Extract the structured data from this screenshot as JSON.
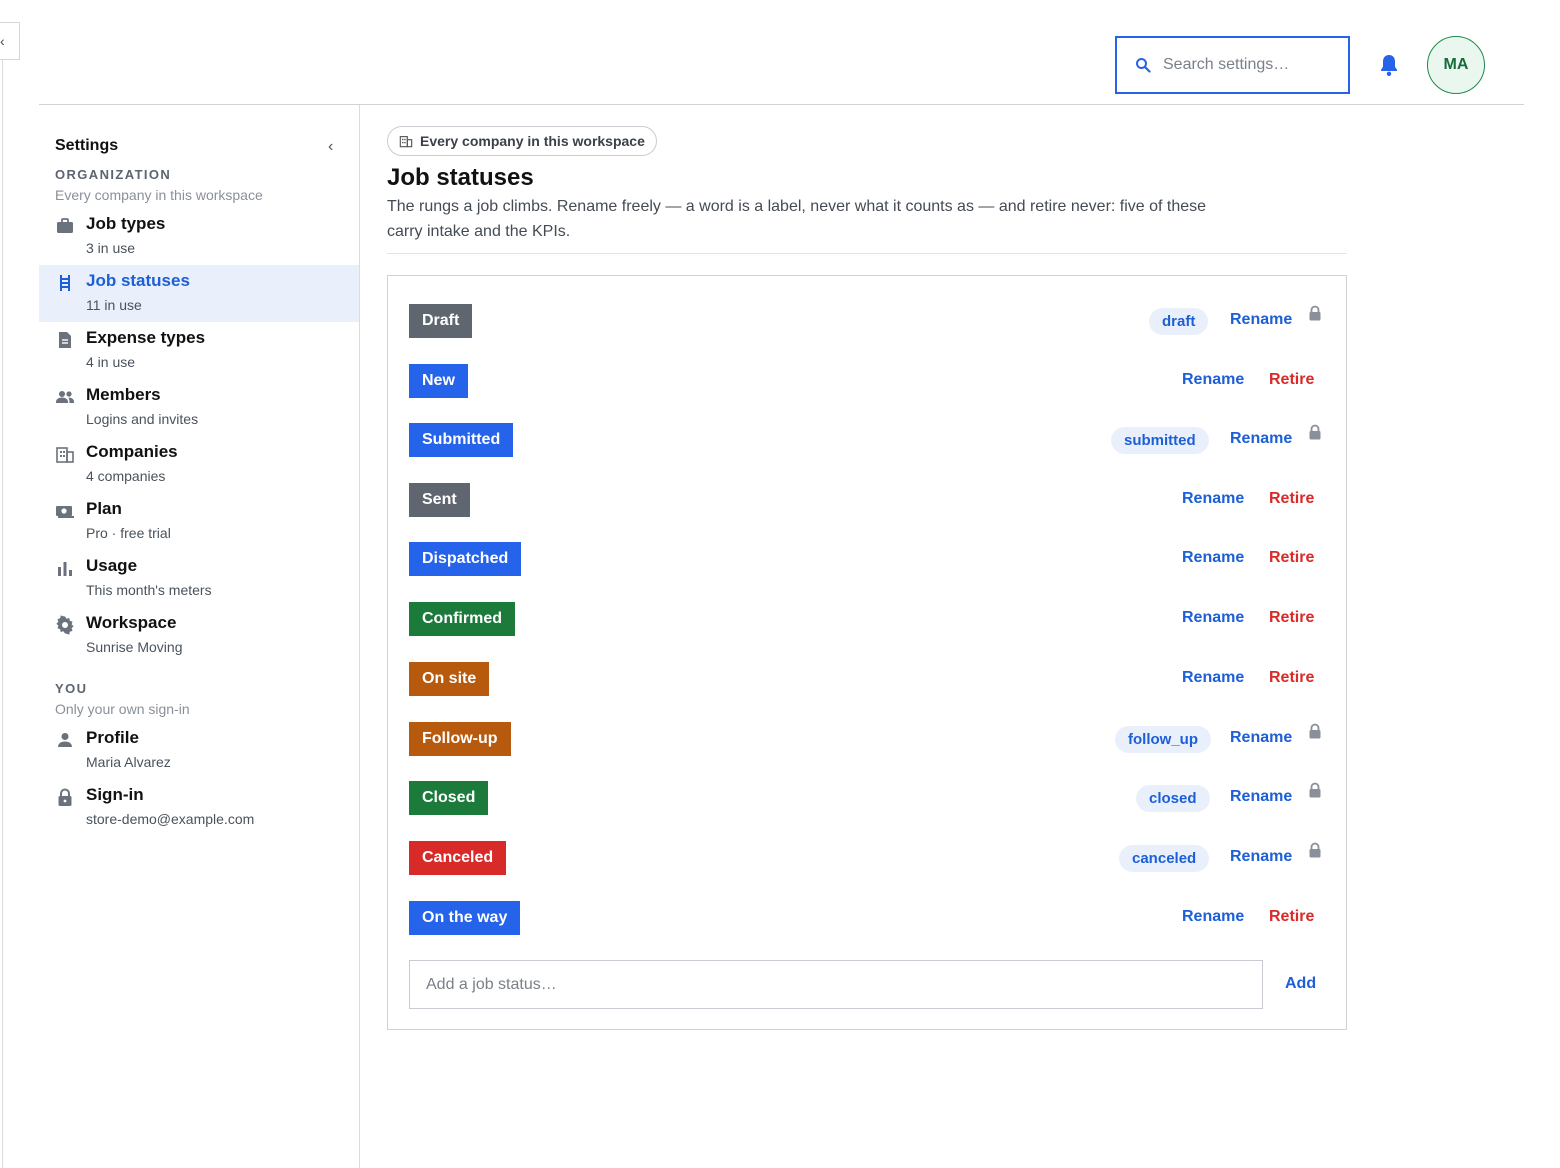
{
  "search": {
    "placeholder": "Search settings…"
  },
  "user": {
    "initials": "MA"
  },
  "sidebar": {
    "title": "Settings",
    "organization": {
      "heading": "ORGANIZATION",
      "sub": "Every company in this workspace",
      "items": [
        {
          "label": "Job types",
          "sub": "3 in use",
          "icon": "briefcase-icon"
        },
        {
          "label": "Job statuses",
          "sub": "11 in use",
          "icon": "ladder-icon",
          "active": true
        },
        {
          "label": "Expense types",
          "sub": "4 in use",
          "icon": "document-icon"
        },
        {
          "label": "Members",
          "sub": "Logins and invites",
          "icon": "people-icon"
        },
        {
          "label": "Companies",
          "sub": "4 companies",
          "icon": "building-icon"
        },
        {
          "label": "Plan",
          "sub": "Pro · free trial",
          "icon": "money-icon"
        },
        {
          "label": "Usage",
          "sub": "This month's meters",
          "icon": "bar-chart-icon"
        },
        {
          "label": "Workspace",
          "sub": "Sunrise Moving",
          "icon": "gear-icon"
        }
      ]
    },
    "you": {
      "heading": "YOU",
      "sub": "Only your own sign-in",
      "items": [
        {
          "label": "Profile",
          "sub": "Maria Alvarez",
          "icon": "person-icon"
        },
        {
          "label": "Sign-in",
          "sub": "store-demo@example.com",
          "icon": "lock-icon"
        }
      ]
    }
  },
  "main": {
    "scope_pill": "Every company in this workspace",
    "title": "Job statuses",
    "description": "The rungs a job climbs. Rename freely — a word is a label, never what it counts as — and retire never: five of these carry intake and the KPIs.",
    "rename_label": "Rename",
    "retire_label": "Retire",
    "statuses": [
      {
        "label": "Draft",
        "color": "#5f6670",
        "key": "draft",
        "locked": true
      },
      {
        "label": "New",
        "color": "#2563eb",
        "key": null,
        "locked": false
      },
      {
        "label": "Submitted",
        "color": "#2563eb",
        "key": "submitted",
        "locked": true
      },
      {
        "label": "Sent",
        "color": "#5f6670",
        "key": null,
        "locked": false
      },
      {
        "label": "Dispatched",
        "color": "#2563eb",
        "key": null,
        "locked": false
      },
      {
        "label": "Confirmed",
        "color": "#1c7a3b",
        "key": null,
        "locked": false
      },
      {
        "label": "On site",
        "color": "#b75a0e",
        "key": null,
        "locked": false
      },
      {
        "label": "Follow-up",
        "color": "#b75a0e",
        "key": "follow_up",
        "locked": true
      },
      {
        "label": "Closed",
        "color": "#1c7a3b",
        "key": "closed",
        "locked": true
      },
      {
        "label": "Canceled",
        "color": "#d92a2a",
        "key": "canceled",
        "locked": true
      },
      {
        "label": "On the way",
        "color": "#2563eb",
        "key": null,
        "locked": false
      }
    ],
    "add_placeholder": "Add a job status…",
    "add_label": "Add"
  }
}
